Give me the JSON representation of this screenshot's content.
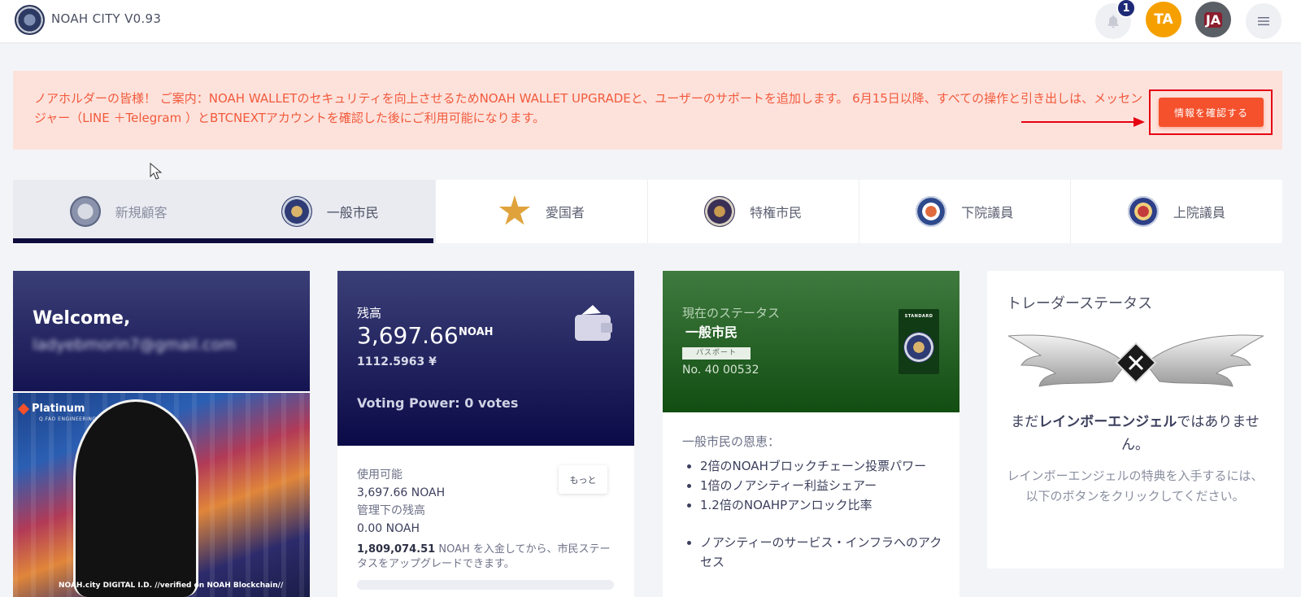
{
  "header": {
    "app_title": "NOAH CITY V0.93",
    "notification_count": "1",
    "avatar_ta": "TA",
    "avatar_ja": "JA",
    "icons": [
      "logo",
      "bell-icon",
      "hamburger-menu-icon"
    ]
  },
  "alert": {
    "message": "ノアホルダーの皆様！ ご案内：NOAH WALLETのセキュリティを向上させるためNOAH WALLET UPGRADEと、ユーザーのサポートを追加します。 6月15日以降、すべての操作と引き出しは、メッセンジャー（LINE ＋Telegram ）とBTCNEXTアカウントを確認した後にご利用可能になります。",
    "button_label": "情報を確認する",
    "text_color": "#f25a3c",
    "background_color": "#fde2dc"
  },
  "tiers": [
    {
      "label": "新規顧客",
      "state": "done"
    },
    {
      "label": "一般市民",
      "state": "active"
    },
    {
      "label": "愛国者",
      "state": "locked"
    },
    {
      "label": "特権市民",
      "state": "locked"
    },
    {
      "label": "下院議員",
      "state": "locked"
    },
    {
      "label": "上院議員",
      "state": "locked"
    }
  ],
  "profile": {
    "welcome": "Welcome,",
    "email": "ladyebmorin7@gmail.com",
    "card_brand": "Platinum",
    "card_brand_sub": "Q.FAO ENGINEERING",
    "id_text": "NOAH.city DIGITAL I.D. //verified on NOAH Blockchain//"
  },
  "balance": {
    "label": "残高",
    "amount": "3,697.66",
    "unit": "NOAH",
    "yen": "1112.5963 ¥",
    "voting": "Voting Power: 0 votes",
    "available_label": "使用可能",
    "available_value": "3,697.66 NOAH",
    "managed_label": "管理下の残高",
    "managed_value": "0.00 NOAH",
    "more_button": "もっと",
    "upgrade_amount": "1,809,074.51",
    "upgrade_text": " NOAH を入金してから、市民ステータスをアップグレードできます。"
  },
  "status": {
    "label": "現在のステータス",
    "value": "一般市民",
    "passport_tag": "パスポート",
    "number": "No. 40 00532",
    "passport_title": "STANDARD",
    "benefits_title": "一般市民の恩恵：",
    "benefits": [
      "2倍のNOAHブロックチェーン投票パワー",
      "1倍のノアシティー利益シェアー",
      "1.2倍のNOAHPアンロック比率",
      "ノアシティーのサービス・インフラへのアクセス"
    ]
  },
  "trader": {
    "title": "トレーダーステータス",
    "main_prefix": "まだ",
    "main_bold": "レインボーエンジェル",
    "main_suffix": "ではありません。",
    "sub": "レインボーエンジェルの特典を入手するには、以下のボタンをクリックしてください。"
  },
  "colors": {
    "navy": "#0d0c3c",
    "accent_red": "#f4512c",
    "green_card": "#124d12",
    "avatar_orange": "#f5a000"
  }
}
